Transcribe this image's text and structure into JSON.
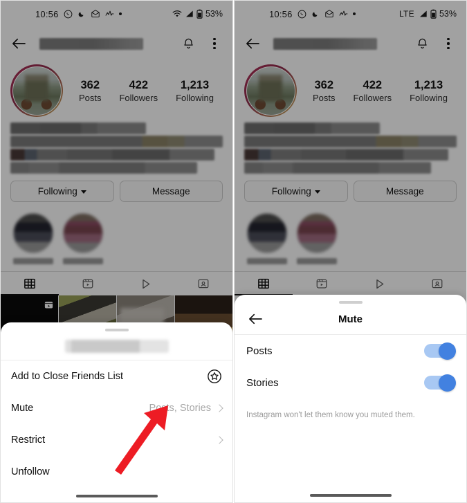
{
  "panels": {
    "left": {
      "status_bar": {
        "time": "10:56",
        "icons": [
          "whatsapp-icon",
          "moon-icon",
          "mail-icon",
          "pulse-icon",
          "dot-icon"
        ],
        "network": "wifi",
        "battery": "53%"
      },
      "appbar": {
        "back": "back-arrow-icon",
        "title": "",
        "notify": "bell-icon",
        "more": "kebab-menu-icon"
      },
      "profile": {
        "stats": [
          {
            "num": "362",
            "label": "Posts"
          },
          {
            "num": "422",
            "label": "Followers"
          },
          {
            "num": "1,213",
            "label": "Following"
          }
        ],
        "bio": "",
        "buttons": [
          {
            "label": "Following",
            "has_chevron": true
          },
          {
            "label": "Message",
            "has_chevron": false
          }
        ],
        "tabs": [
          "grid-tab",
          "reels-tab",
          "video-tab",
          "tagged-tab"
        ],
        "active_tab": 0
      },
      "sheet": {
        "username": "",
        "items": [
          {
            "label": "Add to Close Friends List",
            "value": "",
            "trailing": "close-friends-star-icon"
          },
          {
            "label": "Mute",
            "value": "Posts, Stories",
            "trailing": "chevron-right-icon"
          },
          {
            "label": "Restrict",
            "value": "",
            "trailing": "chevron-right-icon"
          },
          {
            "label": "Unfollow",
            "value": "",
            "trailing": ""
          }
        ]
      }
    },
    "right": {
      "status_bar": {
        "time": "10:56",
        "icons": [
          "whatsapp-icon",
          "moon-icon",
          "mail-icon",
          "pulse-icon",
          "dot-icon"
        ],
        "network": "LTE",
        "battery": "53%"
      },
      "appbar": {
        "back": "back-arrow-icon",
        "title": "",
        "notify": "bell-icon",
        "more": "kebab-menu-icon"
      },
      "profile": {
        "stats": [
          {
            "num": "362",
            "label": "Posts"
          },
          {
            "num": "422",
            "label": "Followers"
          },
          {
            "num": "1,213",
            "label": "Following"
          }
        ],
        "buttons": [
          {
            "label": "Following",
            "has_chevron": true
          },
          {
            "label": "Message",
            "has_chevron": false
          }
        ]
      },
      "mute_sheet": {
        "title": "Mute",
        "back": "back-arrow-icon",
        "rows": [
          {
            "label": "Posts",
            "enabled": true
          },
          {
            "label": "Stories",
            "enabled": true
          }
        ],
        "note": "Instagram won't let them know you muted them."
      }
    }
  },
  "annotations": {
    "arrows": [
      {
        "name": "arrow-to-mute-row",
        "color": "#ED1C24"
      },
      {
        "name": "arrow-to-stories-toggle",
        "color": "#ED1C24"
      }
    ]
  },
  "colors": {
    "toggle_on": "#4281e0",
    "toggle_track": "#a8c8f3",
    "arrow_red": "#ED1C24",
    "muted_text": "#a6a6a6",
    "ring_gradient_start": "#b4315a",
    "ring_gradient_end": "#c5a15a"
  }
}
